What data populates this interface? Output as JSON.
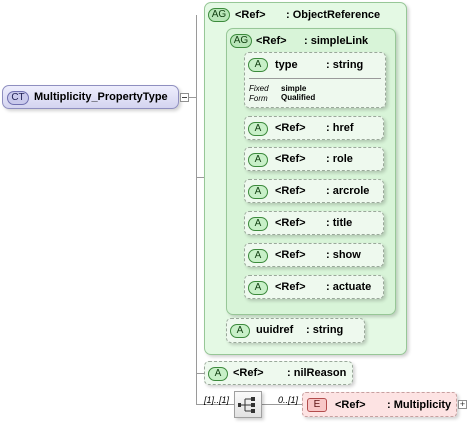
{
  "complex_type": {
    "badge": "CT",
    "label": "Multiplicity_PropertyType"
  },
  "object_reference": {
    "badge": "AG",
    "ref": "<Ref>",
    "type": ": ObjectReference"
  },
  "simple_link": {
    "badge": "AG",
    "ref": "<Ref>",
    "type": ": simpleLink"
  },
  "type_attr": {
    "badge": "A",
    "name": "type",
    "type": ": string",
    "fixed_label": "Fixed",
    "fixed_value": "simple",
    "form_label": "Form",
    "form_value": "Qualified"
  },
  "link_attrs": [
    {
      "badge": "A",
      "ref": "<Ref>",
      "name": ": href"
    },
    {
      "badge": "A",
      "ref": "<Ref>",
      "name": ": role"
    },
    {
      "badge": "A",
      "ref": "<Ref>",
      "name": ": arcrole"
    },
    {
      "badge": "A",
      "ref": "<Ref>",
      "name": ": title"
    },
    {
      "badge": "A",
      "ref": "<Ref>",
      "name": ": show"
    },
    {
      "badge": "A",
      "ref": "<Ref>",
      "name": ": actuate"
    }
  ],
  "uuidref_attr": {
    "badge": "A",
    "name": "uuidref",
    "type": ": string"
  },
  "nil_reason_attr": {
    "badge": "A",
    "ref": "<Ref>",
    "name": ": nilReason"
  },
  "sequence": {
    "cardinality": "[1]..[1]"
  },
  "element": {
    "badge": "E",
    "ref": "<Ref>",
    "name": ": Multiplicity",
    "cardinality": "0..[1]"
  }
}
